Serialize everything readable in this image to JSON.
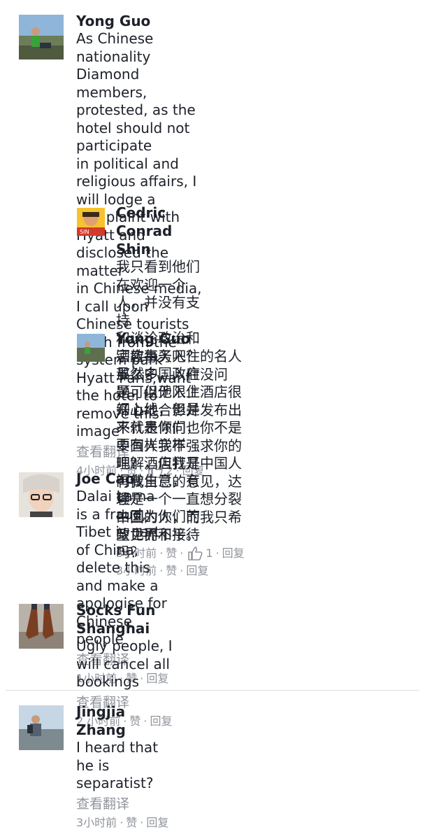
{
  "comments": [
    {
      "name": "Yong Guo",
      "text": "As Chinese nationality Diamond members,\nprotested, as the hotel should not participate\nin political and religious affairs, I will lodge a\ncomplaint with Hyatt and disclosed the matter\nin Chinese media, I call upon Chinese tourists\nwash from the system park Hyatt Paris,want\nthe hotel to remove this image",
      "translate": "查看翻译",
      "time": "4小时前",
      "like": "赞",
      "likes": "2",
      "reply": "回复",
      "replies": [
        {
          "name": "Cedric Conrad Shin",
          "text": "我只看到他们在欢迎一个人，并没有支持\n和谈论政治和宗教事务吧？虽然中国政府\n是可以无限上纲上线，但是不代表你们也\n要有样学样吧？酒店打开门做生意，有理\n由因为你们的政见而不接待吗？",
          "time": "3小时前",
          "like": "赞",
          "reply": "回复"
        },
        {
          "name": "Yong Guo",
          "text": "酒店每天入住的名人那么多，入住没问\n题，但他入住酒店很开心地合影并发布出\n来就是倾向，你不是中国人我不强求你的\n理解，但我是中国人有我自己的意见，达\n赖是一个一直想分裂中国的人，而我只希\n望世界和平。",
          "time": "3小时前",
          "like": "赞",
          "likes": "1",
          "reply": "回复"
        }
      ]
    },
    {
      "name": "Joe Cao",
      "text": "Dalai Lama is a fraud,  Tibet is part of China,\ndelete this and make a apologise for Chinese\npeople",
      "translate": "查看翻译",
      "time": "1小时前",
      "like": "赞",
      "reply": "回复"
    },
    {
      "name": "Socks Fun Shanghai",
      "text": "Ugly people, I will cancel all bookings",
      "translate": "查看翻译",
      "time": "2 小时前",
      "like": "赞",
      "reply": "回复"
    },
    {
      "name": "Jingjia Zhang",
      "text": "I heard that he is separatist?",
      "translate": "查看翻译",
      "time": "3小时前",
      "like": "赞",
      "reply": "回复"
    }
  ],
  "colors": {
    "text": "#1d2129",
    "meta": "#90949c",
    "divider": "#dddfe2"
  }
}
